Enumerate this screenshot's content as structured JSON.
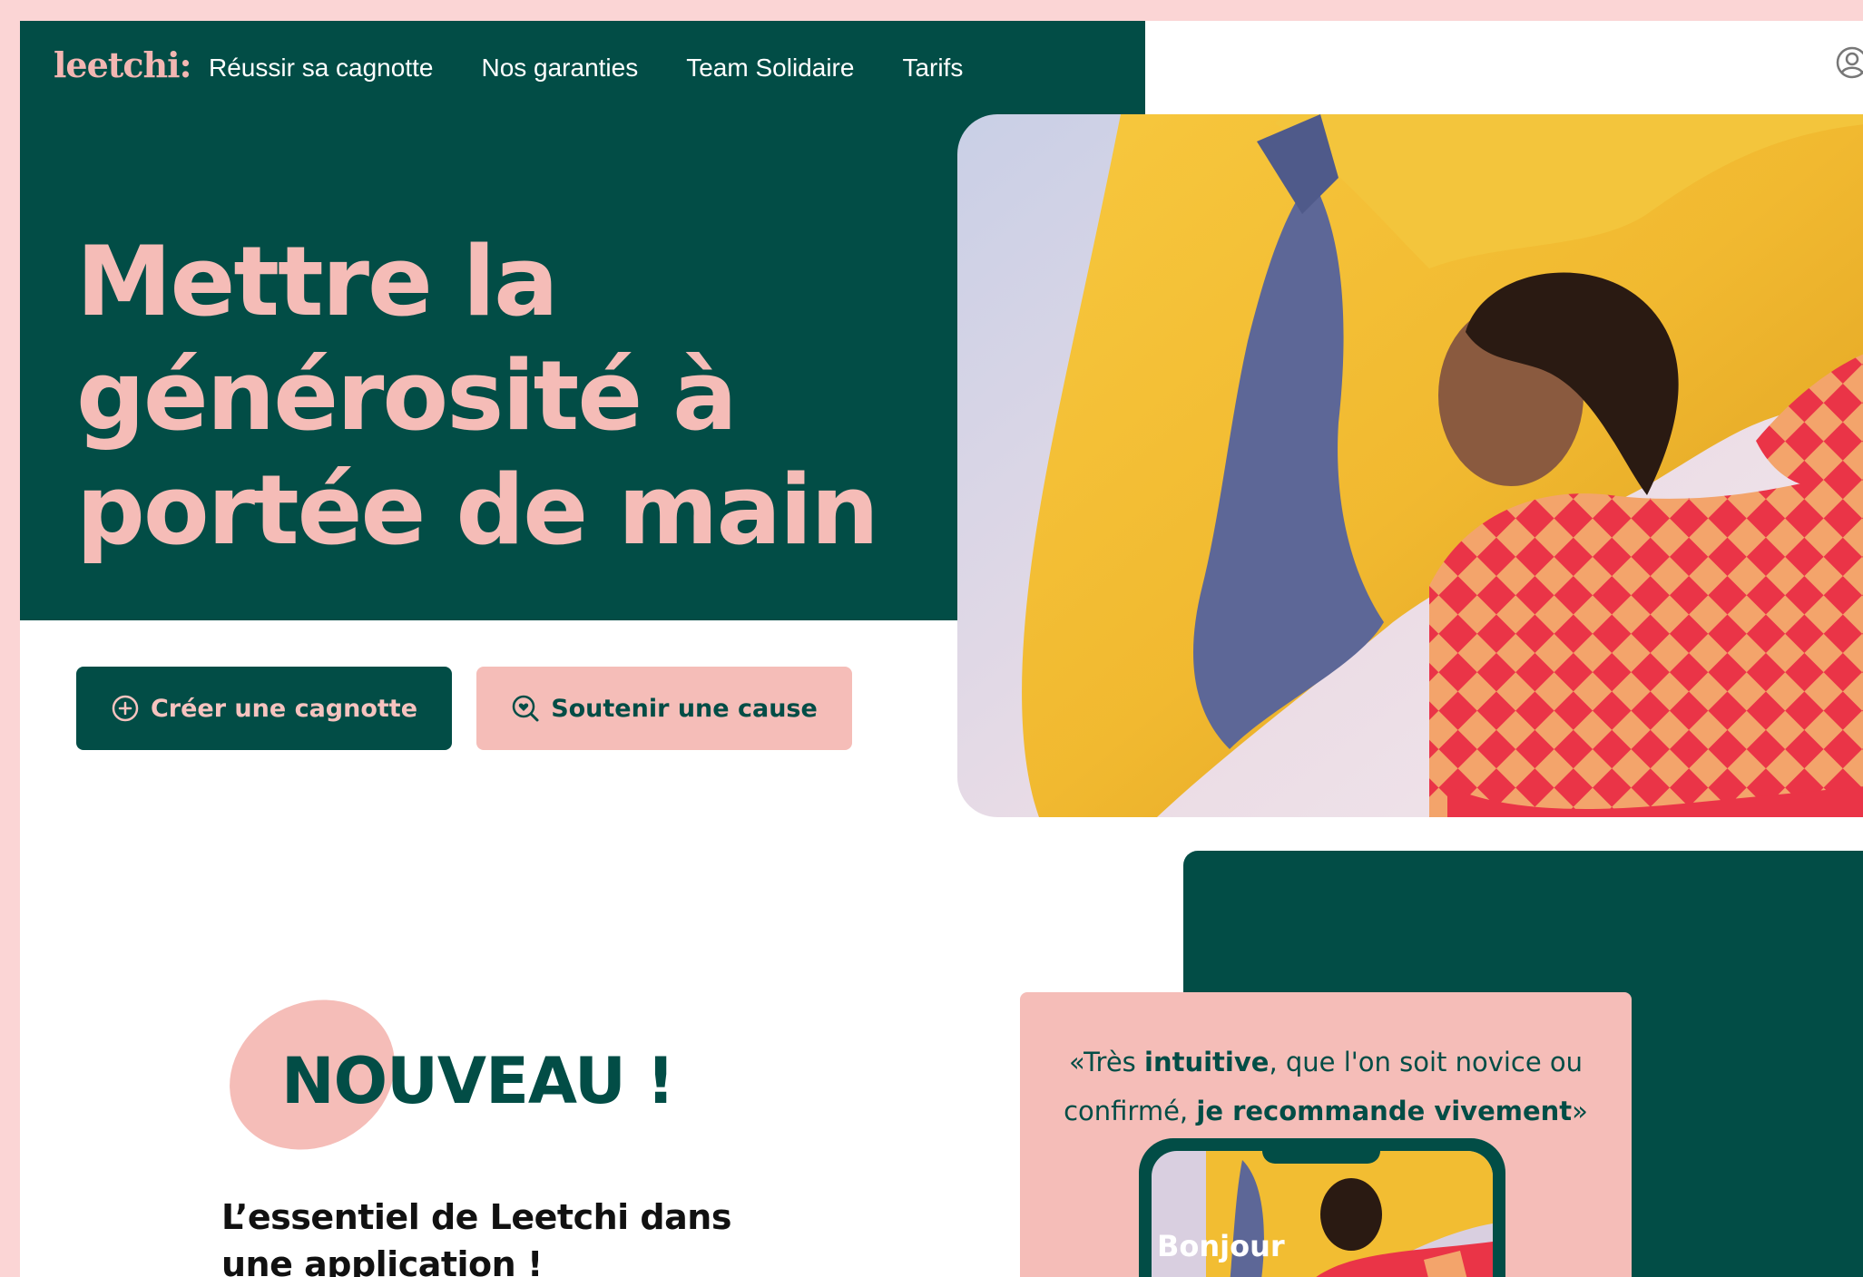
{
  "brand": {
    "logo_text": "leetchi:"
  },
  "nav": {
    "items": [
      {
        "label": "Réussir sa cagnotte"
      },
      {
        "label": "Nos garanties"
      },
      {
        "label": "Team Solidaire"
      },
      {
        "label": "Tarifs"
      }
    ],
    "account_icon": "user-circle-icon"
  },
  "hero": {
    "title_line1": "Mettre la",
    "title_line2": "générosité à",
    "title_line3": "portée de main",
    "primary_button": {
      "label": "Créer une cagnotte",
      "icon": "plus-circle-icon"
    },
    "secondary_button": {
      "label": "Soutenir une cause",
      "icon": "search-heart-icon"
    },
    "image": "person-with-yellow-fabric-photo"
  },
  "app_section": {
    "badge": "NOUVEAU !",
    "subtitle_line1": "L’essentiel de Leetchi dans",
    "subtitle_line2": "une application !"
  },
  "review": {
    "quote_open": "«Très ",
    "quote_strong1": "intuitive",
    "quote_mid": ", que l'on soit novice ou confirmé, ",
    "quote_strong2": "je recommande vivement",
    "quote_close": "»",
    "phone_greeting": "Bonjour"
  },
  "colors": {
    "brand_green": "#024d46",
    "brand_pink": "#f5bdb8",
    "page_border": "#fbd5d5",
    "background": "#ffffff"
  }
}
